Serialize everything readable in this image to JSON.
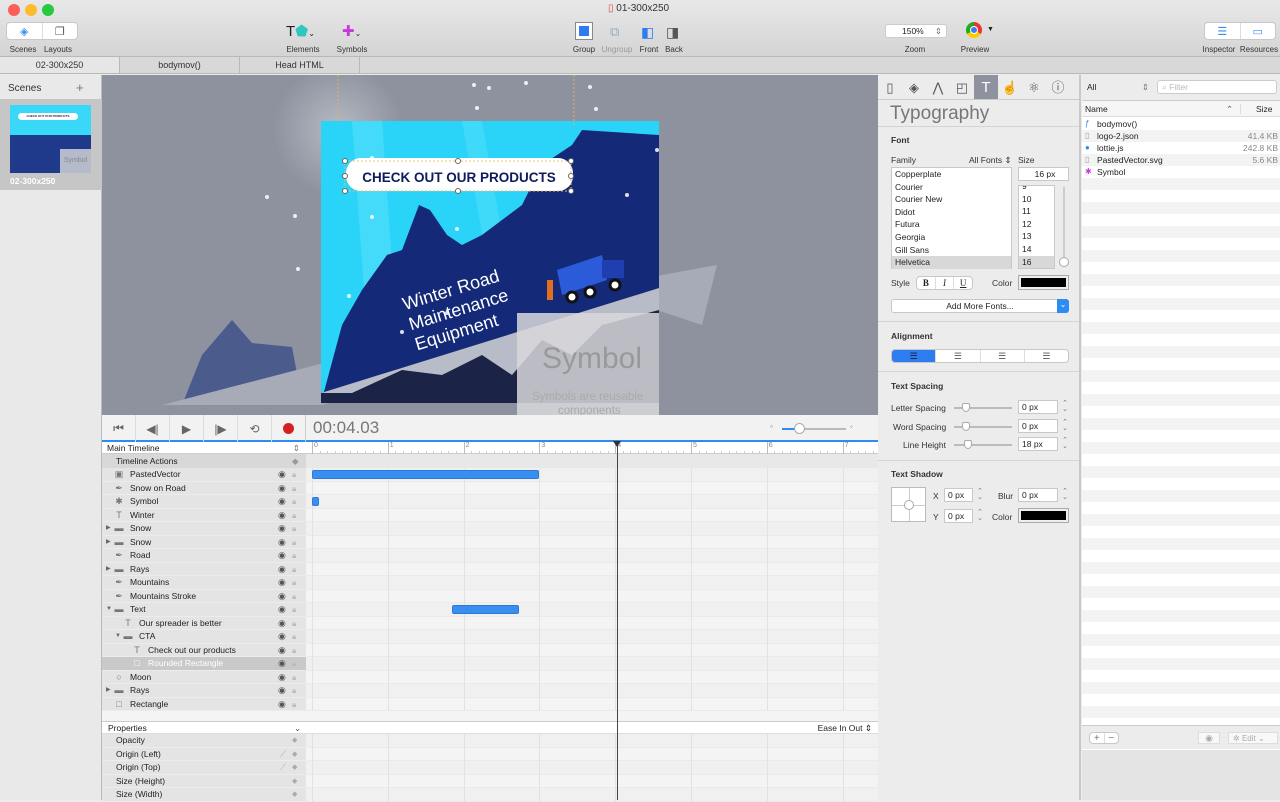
{
  "window": {
    "title": "01-300x250"
  },
  "toolbar": {
    "scenes": "Scenes",
    "layouts": "Layouts",
    "elements": "Elements",
    "symbols": "Symbols",
    "group": "Group",
    "ungroup": "Ungroup",
    "front": "Front",
    "back": "Back",
    "zoom_label": "Zoom",
    "zoom_value": "150%",
    "preview": "Preview",
    "inspector": "Inspector",
    "resources": "Resources"
  },
  "tabs": [
    {
      "label": "02-300x250"
    },
    {
      "label": "bodymov()"
    },
    {
      "label": "Head HTML"
    }
  ],
  "scenes": {
    "title": "Scenes",
    "add": "+",
    "items": [
      {
        "label": "02-300x250",
        "thumb_text": "CHECK OUT OUR PRODUCTS",
        "thumb_title": "Winter Road Maintenance Equipment",
        "thumb_symbol": "Symbol"
      }
    ]
  },
  "stage": {
    "cta": "CHECK OUT OUR PRODUCTS",
    "headline_1": "Winter Road",
    "headline_2": "Maintenance",
    "headline_3": "Equipment",
    "symbol_title": "Symbol",
    "symbol_sub_1": "Symbols are reusable",
    "symbol_sub_2": "components"
  },
  "timeline": {
    "time": "00:04.03",
    "playhead_seconds": 4.03,
    "selector": "Main Timeline",
    "actions": "Timeline Actions",
    "ticks": [
      "0",
      "1",
      "2",
      "3",
      "4",
      "5",
      "6",
      "7"
    ],
    "zoom_slider": 0.2,
    "layers": [
      {
        "name": "PastedVector",
        "icon": "image",
        "indent": 0,
        "bar": [
          0,
          3.0
        ]
      },
      {
        "name": "Snow on Road",
        "icon": "pen",
        "indent": 0
      },
      {
        "name": "Symbol",
        "icon": "puzzle",
        "indent": 0,
        "bar": [
          0,
          0.08
        ]
      },
      {
        "name": "Winter",
        "icon": "T",
        "indent": 0
      },
      {
        "name": "Snow",
        "icon": "folder",
        "indent": 0,
        "expand": "▶"
      },
      {
        "name": "Snow",
        "icon": "folder",
        "indent": 0,
        "expand": "▶"
      },
      {
        "name": "Road",
        "icon": "pen",
        "indent": 0
      },
      {
        "name": "Rays",
        "icon": "folder",
        "indent": 0,
        "expand": "▶"
      },
      {
        "name": "Mountains",
        "icon": "pen",
        "indent": 0
      },
      {
        "name": "Mountains Stroke",
        "icon": "pen",
        "indent": 0
      },
      {
        "name": "Text",
        "icon": "folder",
        "indent": 0,
        "expand": "▼",
        "bar": [
          1.85,
          2.73
        ]
      },
      {
        "name": "Our spreader is better",
        "icon": "T",
        "indent": 1
      },
      {
        "name": "CTA",
        "icon": "folder",
        "indent": 1,
        "expand": "▼"
      },
      {
        "name": "Check out our products",
        "icon": "T",
        "indent": 2
      },
      {
        "name": "Rounded Rectangle",
        "icon": "rect",
        "indent": 2,
        "selected": true
      },
      {
        "name": "Moon",
        "icon": "circle",
        "indent": 0
      },
      {
        "name": "Rays",
        "icon": "folder",
        "indent": 0,
        "expand": "▶"
      },
      {
        "name": "Rectangle",
        "icon": "rect",
        "indent": 0
      }
    ],
    "properties_label": "Properties",
    "easing": "Ease In Out",
    "properties": [
      {
        "name": "Opacity"
      },
      {
        "name": "Origin (Left)",
        "handle": true
      },
      {
        "name": "Origin (Top)",
        "handle": true
      },
      {
        "name": "Size (Height)"
      },
      {
        "name": "Size (Width)"
      }
    ]
  },
  "inspector": {
    "title": "Typography",
    "font_section": "Font",
    "family_label": "Family",
    "family_filter": "All Fonts",
    "size_label": "Size",
    "size_value": "16 px",
    "families": [
      "Copperplate",
      "Courier",
      "Courier New",
      "Didot",
      "Futura",
      "Georgia",
      "Gill Sans",
      "Helvetica"
    ],
    "selected_family": "Helvetica",
    "sizes": [
      "9",
      "10",
      "11",
      "12",
      "13",
      "14",
      "16"
    ],
    "selected_size": "16",
    "style_label": "Style",
    "bold": "B",
    "italic": "I",
    "underline": "U",
    "color_label": "Color",
    "color": "#000000",
    "add_fonts": "Add More Fonts...",
    "alignment": "Alignment",
    "alignment_selected": "left",
    "spacing": "Text Spacing",
    "letter_label": "Letter Spacing",
    "letter": "0 px",
    "word_label": "Word Spacing",
    "word": "0 px",
    "line_label": "Line Height",
    "line": "18 px",
    "shadow": "Text Shadow",
    "x_label": "X",
    "x": "0 px",
    "y_label": "Y",
    "y": "0 px",
    "blur_label": "Blur",
    "blur": "0 px",
    "shadow_color_label": "Color",
    "shadow_color": "#000000"
  },
  "resources": {
    "filter_select": "All",
    "filter_placeholder": "Filter",
    "col_name": "Name",
    "col_size": "Size",
    "items": [
      {
        "name": "bodymov()",
        "size": "",
        "icon": "function"
      },
      {
        "name": "logo-2.json",
        "size": "41.4 KB",
        "icon": "file"
      },
      {
        "name": "lottie.js",
        "size": "242.8 KB",
        "icon": "js"
      },
      {
        "name": "PastedVector.svg",
        "size": "5.6 KB",
        "icon": "file"
      },
      {
        "name": "Symbol",
        "size": "",
        "icon": "symbol"
      }
    ],
    "add": "+",
    "remove": "−",
    "edit": "Edit"
  },
  "colors": {
    "accent": "#2d8cf0",
    "sky": "#2ad4f8",
    "mountain": "#142a78",
    "record": "#d42020"
  }
}
